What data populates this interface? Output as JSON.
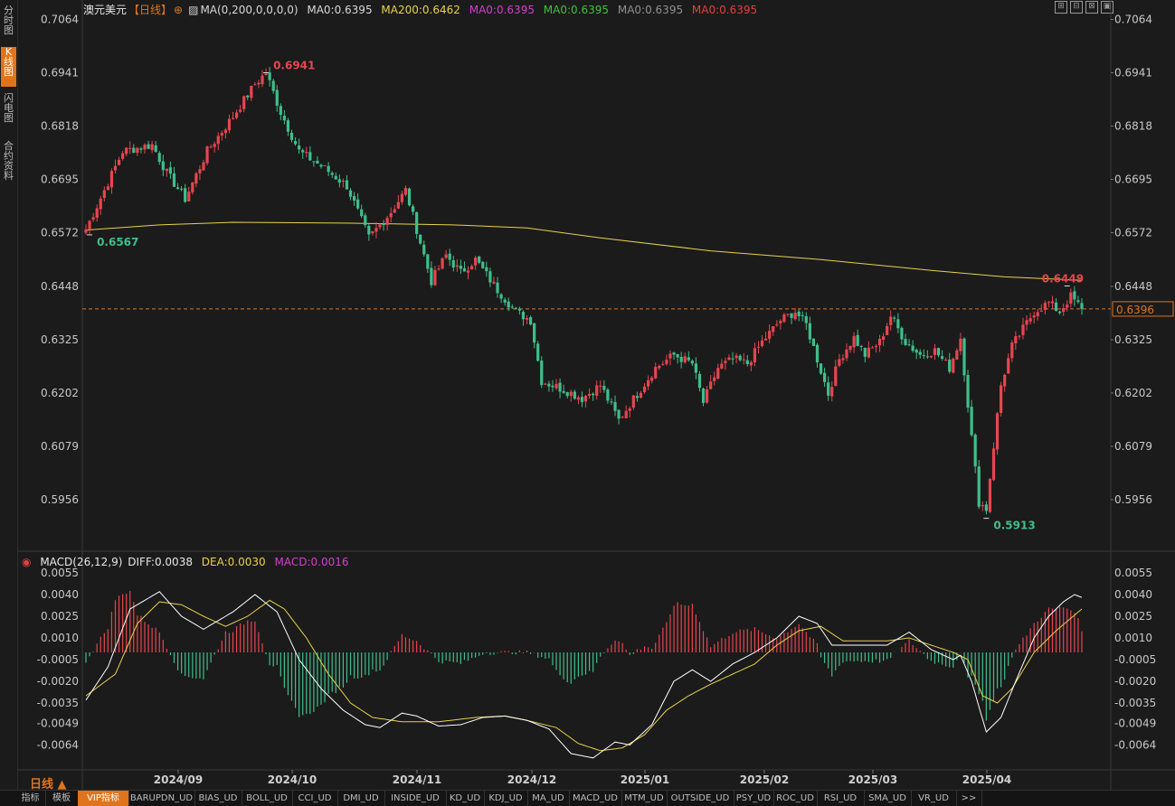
{
  "left_tabs": [
    {
      "label": "分时图",
      "active": false
    },
    {
      "label": "K线图",
      "active": true
    },
    {
      "label": "闪电图",
      "active": false
    },
    {
      "label": "合约资料",
      "active": false
    }
  ],
  "main_legend": {
    "symbol": "澳元美元",
    "period": "【日线】",
    "settings_icon": "⊕",
    "ma_params": "MA(0,200,0,0,0,0)",
    "items": [
      {
        "text": "MA0:0.6395",
        "color": "#d8d8d8"
      },
      {
        "text": "MA200:0.6462",
        "color": "#e8d24a"
      },
      {
        "text": "MA0:0.6395",
        "color": "#d040d0"
      },
      {
        "text": "MA0:0.6395",
        "color": "#40c040"
      },
      {
        "text": "MA0:0.6395",
        "color": "#909090"
      },
      {
        "text": "MA0:0.6395",
        "color": "#e04040"
      }
    ]
  },
  "window_controls": [
    "⊞",
    "⊟",
    "⊠",
    "▣"
  ],
  "price_axis": {
    "ticks": [
      "0.7064",
      "0.6941",
      "0.6818",
      "0.6695",
      "0.6572",
      "0.6448",
      "0.6325",
      "0.6202",
      "0.6079",
      "0.5956"
    ],
    "current_price": "0.6396"
  },
  "price_annotations": {
    "high": "0.6941",
    "start_low": "0.6567",
    "recent_high": "0.6449",
    "low": "0.5913"
  },
  "macd_legend": {
    "name": "MACD(26,12,9)",
    "diff": "DIFF:0.0038",
    "dea": "DEA:0.0030",
    "macd": "MACD:0.0016"
  },
  "macd_axis": {
    "ticks": [
      "0.0055",
      "0.0040",
      "0.0025",
      "0.0010",
      "-0.0005",
      "-0.0020",
      "-0.0035",
      "-0.0049",
      "-0.0064"
    ]
  },
  "date_axis": [
    "2024/09",
    "2024/10",
    "2024/11",
    "2024/12",
    "2025/01",
    "2025/02",
    "2025/03",
    "2025/04"
  ],
  "period_selector": "日线 ▲",
  "bottom_tabs": [
    {
      "label": "指标",
      "active": false
    },
    {
      "label": "模板",
      "active": false
    },
    {
      "label": "VIP指标",
      "active": true
    },
    {
      "label": "BARUPDN_UD",
      "active": false
    },
    {
      "label": "BIAS_UD",
      "active": false
    },
    {
      "label": "BOLL_UD",
      "active": false
    },
    {
      "label": "CCI_UD",
      "active": false
    },
    {
      "label": "DMI_UD",
      "active": false
    },
    {
      "label": "INSIDE_UD",
      "active": false
    },
    {
      "label": "KD_UD",
      "active": false
    },
    {
      "label": "KDJ_UD",
      "active": false
    },
    {
      "label": "MA_UD",
      "active": false
    },
    {
      "label": "MACD_UD",
      "active": false
    },
    {
      "label": "MTM_UD",
      "active": false
    },
    {
      "label": "OUTSIDE_UD",
      "active": false
    },
    {
      "label": "PSY_UD",
      "active": false
    },
    {
      "label": "ROC_UD",
      "active": false
    },
    {
      "label": "RSI_UD",
      "active": false
    },
    {
      "label": "SMA_UD",
      "active": false
    },
    {
      "label": "VR_UD",
      "active": false
    },
    {
      "label": ">>",
      "active": false
    }
  ],
  "chart_data": [
    {
      "type": "candlestick",
      "title": "澳元美元",
      "ylim": [
        0.59,
        0.707
      ],
      "up_color": "#e8454f",
      "down_color": "#3fbf8c",
      "ma200_color": "#e8d24a",
      "current_price": 0.6396,
      "anchors": [
        [
          0,
          0.658
        ],
        [
          10,
          0.676
        ],
        [
          18,
          0.6775
        ],
        [
          22,
          0.671
        ],
        [
          27,
          0.665
        ],
        [
          33,
          0.676
        ],
        [
          40,
          0.684
        ],
        [
          46,
          0.6915
        ],
        [
          49,
          0.6941
        ],
        [
          53,
          0.685
        ],
        [
          58,
          0.676
        ],
        [
          65,
          0.672
        ],
        [
          71,
          0.668
        ],
        [
          77,
          0.656
        ],
        [
          83,
          0.662
        ],
        [
          87,
          0.667
        ],
        [
          90,
          0.658
        ],
        [
          94,
          0.646
        ],
        [
          98,
          0.652
        ],
        [
          102,
          0.648
        ],
        [
          106,
          0.651
        ],
        [
          112,
          0.644
        ],
        [
          117,
          0.639
        ],
        [
          121,
          0.637
        ],
        [
          124,
          0.623
        ],
        [
          130,
          0.621
        ],
        [
          135,
          0.619
        ],
        [
          140,
          0.622
        ],
        [
          145,
          0.614
        ],
        [
          150,
          0.62
        ],
        [
          155,
          0.626
        ],
        [
          160,
          0.629
        ],
        [
          165,
          0.627
        ],
        [
          168,
          0.618
        ],
        [
          172,
          0.626
        ],
        [
          176,
          0.628
        ],
        [
          180,
          0.627
        ],
        [
          184,
          0.632
        ],
        [
          189,
          0.637
        ],
        [
          193,
          0.639
        ],
        [
          196,
          0.636
        ],
        [
          199,
          0.628
        ],
        [
          202,
          0.62
        ],
        [
          205,
          0.628
        ],
        [
          209,
          0.633
        ],
        [
          212,
          0.629
        ],
        [
          216,
          0.632
        ],
        [
          219,
          0.638
        ],
        [
          223,
          0.632
        ],
        [
          227,
          0.629
        ],
        [
          231,
          0.63
        ],
        [
          235,
          0.626
        ],
        [
          238,
          0.633
        ],
        [
          241,
          0.61
        ],
        [
          243,
          0.595
        ],
        [
          245,
          0.5935
        ],
        [
          247,
          0.608
        ],
        [
          249,
          0.622
        ],
        [
          252,
          0.631
        ],
        [
          255,
          0.635
        ],
        [
          258,
          0.639
        ],
        [
          262,
          0.641
        ],
        [
          265,
          0.639
        ],
        [
          268,
          0.6425
        ],
        [
          271,
          0.6396
        ]
      ],
      "annotations": [
        {
          "label": "0.6941",
          "value": 0.6941,
          "index": 49
        },
        {
          "label": "0.6567",
          "value": 0.6567,
          "index": 1
        },
        {
          "label": "0.6449",
          "value": 0.6449,
          "index": 267
        },
        {
          "label": "0.5913",
          "value": 0.5913,
          "index": 245
        }
      ]
    },
    {
      "type": "line+bar",
      "title": "MACD(26,12,9)",
      "ylim": [
        -0.0075,
        0.0058
      ],
      "diff": 0.0038,
      "dea": 0.003,
      "macd": 0.0016,
      "series": [
        {
          "name": "DIFF",
          "color": "#ffffff"
        },
        {
          "name": "DEA",
          "color": "#e8d24a"
        },
        {
          "name": "MACD",
          "color": "#d040d0"
        }
      ]
    }
  ]
}
